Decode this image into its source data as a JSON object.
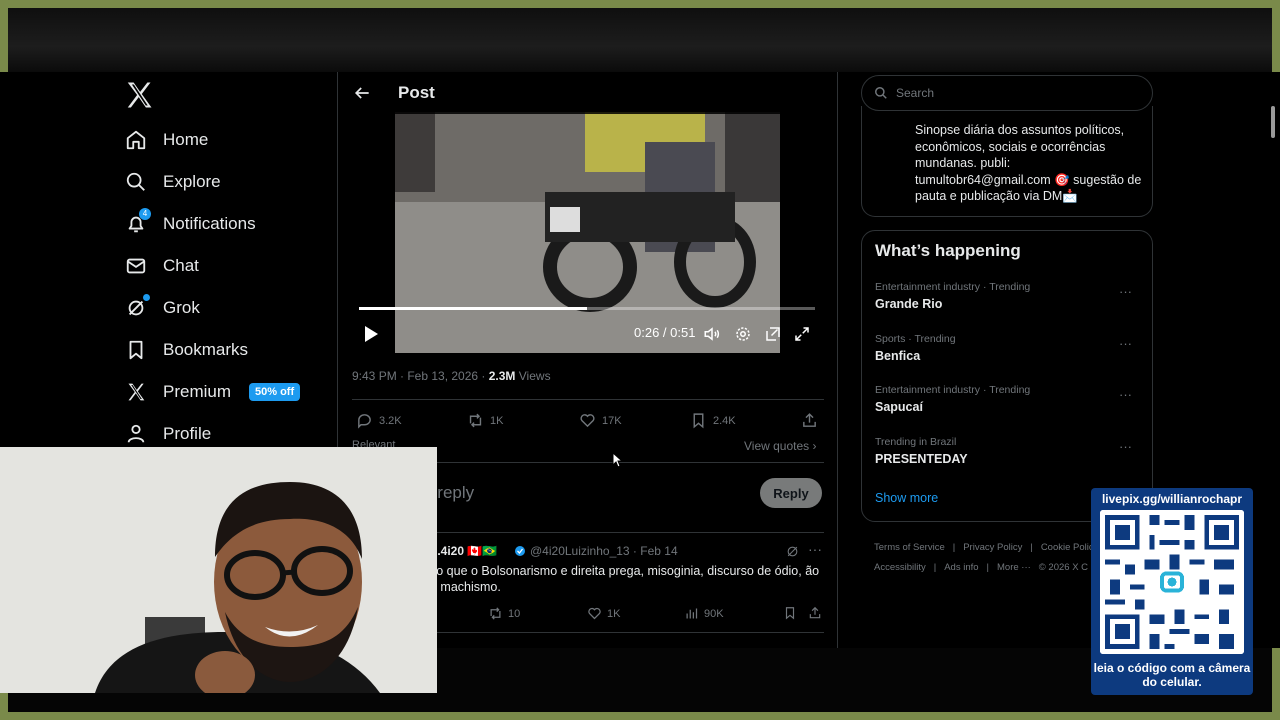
{
  "nav": {
    "items": [
      {
        "label": "Home",
        "icon": "home-icon"
      },
      {
        "label": "Explore",
        "icon": "search-icon"
      },
      {
        "label": "Notifications",
        "icon": "bell-icon",
        "badge": "4"
      },
      {
        "label": "Chat",
        "icon": "mail-icon"
      },
      {
        "label": "Grok",
        "icon": "grok-icon"
      },
      {
        "label": "Bookmarks",
        "icon": "bookmark-icon"
      },
      {
        "label": "Premium",
        "icon": "x-logo-icon",
        "badge": "50% off"
      },
      {
        "label": "Profile",
        "icon": "person-icon"
      }
    ]
  },
  "header": {
    "title": "Post"
  },
  "video": {
    "time": "0:26 / 0:51",
    "progress": 0.5
  },
  "post": {
    "time": "9:43 PM · Feb 13, 2026 · ",
    "views_count": "2.3M",
    "views_label": " Views",
    "replies": "3.2K",
    "reposts": "1K",
    "likes": "17K",
    "bookmarks": "2.4K"
  },
  "replies_section": {
    "sort": "Relevant",
    "view_quotes": "View quotes",
    "placeholder": "our reply",
    "reply_button": "Reply"
  },
  "reply": {
    "name": "o.4i20 🇨🇦🇧🇷",
    "handle": "@4i20Luizinho_13 · Feb 14",
    "text": "so que o Bolsonarismo e direita prega, misoginia, discurso de ódio, ão e machismo.",
    "reposts": "10",
    "likes": "1K",
    "views": "90K"
  },
  "search": {
    "placeholder": "Search"
  },
  "bio": {
    "text": "Sinopse diária dos assuntos políticos, econômicos, sociais e ocorrências mundanas. publi: tumultobr64@gmail.com 🎯 sugestão de pauta e publicação via DM📩"
  },
  "trending": {
    "title": "What’s happening",
    "items": [
      {
        "category": "Entertainment industry · Trending",
        "name": "Grande Rio"
      },
      {
        "category": "Sports · Trending",
        "name": "Benfica"
      },
      {
        "category": "Entertainment industry · Trending",
        "name": "Sapucaí"
      },
      {
        "category": "Trending in Brazil",
        "name": "PRESENTEDAY"
      }
    ],
    "show_more": "Show more"
  },
  "footer": {
    "links": [
      "Terms of Service",
      "|",
      "Privacy Policy",
      "|",
      "Cookie Polic",
      "Accessibility",
      "|",
      "Ads info",
      "|",
      "More ···",
      "© 2026 X C"
    ]
  },
  "qr": {
    "url": "livepix.gg/willianrochapr",
    "caption": "leia o código com a câmera do celular."
  },
  "colors": {
    "accent": "#1d9bf0",
    "background": "#000000",
    "border": "#2f3336",
    "muted": "#71767b",
    "overlay_blue": "#0d3a7f"
  }
}
